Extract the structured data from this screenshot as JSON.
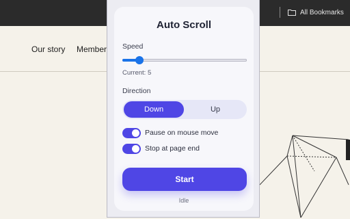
{
  "browser": {
    "bookmarks_label": "All Bookmarks"
  },
  "site": {
    "nav": [
      "Our story",
      "Members"
    ]
  },
  "popup": {
    "title": "Auto Scroll",
    "speed_label": "Speed",
    "speed_value": 5,
    "speed_min": 1,
    "speed_max": 30,
    "current_text": "Current: 5",
    "direction_label": "Direction",
    "direction_options": [
      "Down",
      "Up"
    ],
    "direction_selected": "Down",
    "toggles": [
      {
        "label": "Pause on mouse move",
        "on": true
      },
      {
        "label": "Stop at page end",
        "on": true
      }
    ],
    "start_label": "Start",
    "status": "Idle"
  },
  "colors": {
    "accent": "#4f46e5",
    "slider": "#1a73e8",
    "segment_bg": "#e6e7f7"
  }
}
